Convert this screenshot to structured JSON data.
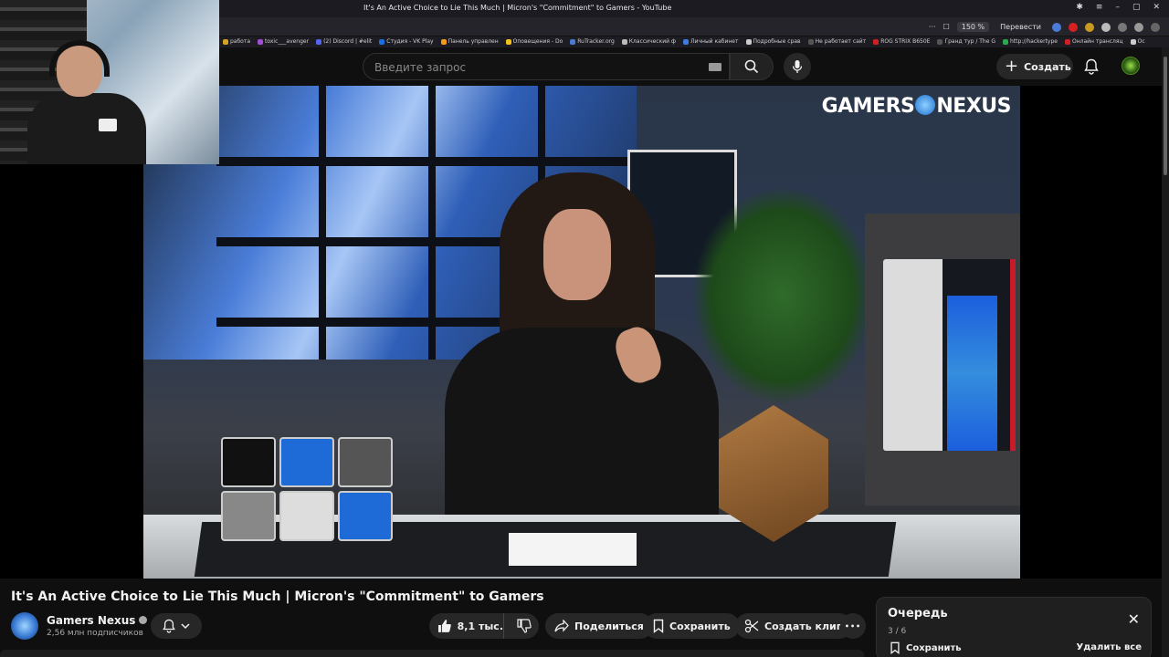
{
  "window": {
    "title": "It's An Active Choice to Lie This Much | Micron's \"Commitment\" to Gamers - YouTube",
    "zoom": "150 %",
    "translate": "Перевести"
  },
  "bookmarks": [
    {
      "label": "работа",
      "color": "#d7a21f"
    },
    {
      "label": "toxic___avenger",
      "color": "#a24fd8"
    },
    {
      "label": "(2) Discord | #elit",
      "color": "#5865f2"
    },
    {
      "label": "Студия - VK Play",
      "color": "#1d6fe0"
    },
    {
      "label": "Панель управлен",
      "color": "#f29a1a"
    },
    {
      "label": "Оповещения - Do",
      "color": "#f2c21a"
    },
    {
      "label": "RuTracker.org",
      "color": "#4b7bd1"
    },
    {
      "label": "Классический ф",
      "color": "#bbbbbb"
    },
    {
      "label": "Личный кабинет",
      "color": "#3d7be0"
    },
    {
      "label": "Подробные срав",
      "color": "#cccccc"
    },
    {
      "label": "Не работает сайт",
      "color": "#555555"
    },
    {
      "label": "ROG STRIX B650E",
      "color": "#d32020"
    },
    {
      "label": "Гранд тур / The G",
      "color": "#555555"
    },
    {
      "label": "http://hackertype",
      "color": "#2ea84e"
    },
    {
      "label": "Онлайн трансляц",
      "color": "#d32020"
    },
    {
      "label": "Ос",
      "color": "#cccccc"
    }
  ],
  "header": {
    "search_placeholder": "Введите запрос",
    "create_label": "Создать"
  },
  "video": {
    "title": "It's An Active Choice to Lie This Much | Micron's \"Commitment\" to Gamers",
    "overlay_logo_left": "GAMERS",
    "overlay_logo_right": "NEXUS"
  },
  "channel": {
    "name": "Gamers Nexus",
    "subscribers": "2,56 млн подписчиков"
  },
  "actions": {
    "likes": "8,1 тыс.",
    "share": "Поделиться",
    "save": "Сохранить",
    "clip": "Создать клип",
    "more": "•••"
  },
  "queue": {
    "title": "Очередь",
    "count": "3 / 6",
    "save": "Сохранить",
    "clear": "Удалить все"
  },
  "colors": {
    "background": "#0f0f0f",
    "pill": "#272727",
    "text": "#f1f1f1",
    "muted": "#aaaaaa"
  }
}
